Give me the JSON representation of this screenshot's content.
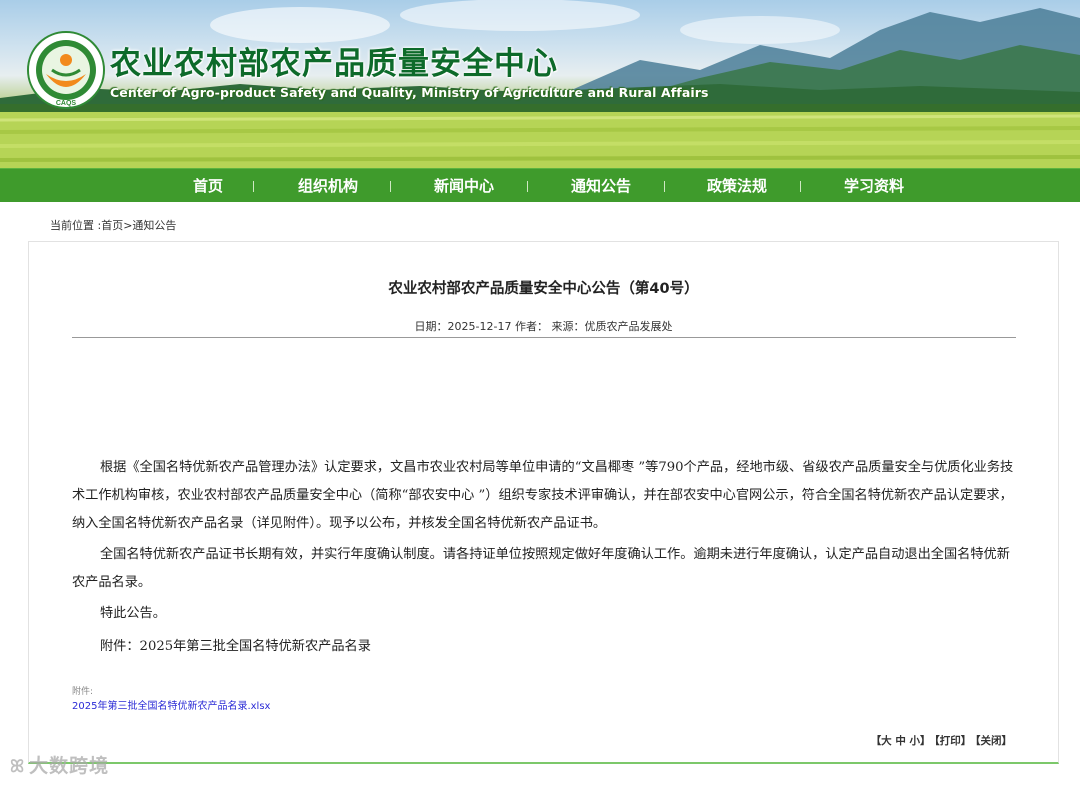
{
  "header": {
    "title": "农业农村部农产品质量安全中心",
    "subtitle": "Center of Agro-product Safety and Quality, Ministry of Agriculture and Rural Affairs",
    "logo_text": "CAQS"
  },
  "nav": {
    "items": [
      {
        "label": "首页"
      },
      {
        "label": "组织机构"
      },
      {
        "label": "新闻中心"
      },
      {
        "label": "通知公告"
      },
      {
        "label": "政策法规"
      },
      {
        "label": "学习资料"
      }
    ]
  },
  "breadcrumb": {
    "prefix": "当前位置 :",
    "home": "首页",
    "separator": ">",
    "current": "通知公告"
  },
  "article": {
    "title": "农业农村部农产品质量安全中心公告（第40号）",
    "meta": "日期：2025-12-17 作者： 来源：优质农产品发展处",
    "paragraphs": [
      "根据《全国名特优新农产品管理办法》认定要求，文昌市农业农村局等单位申请的“文昌椰枣 ”等790个产品，经地市级、省级农产品质量安全与优质化业务技术工作机构审核，农业农村部农产品质量安全中心（简称“部农安中心 ”）组织专家技术评审确认，并在部农安中心官网公示，符合全国名特优新农产品认定要求，纳入全国名特优新农产品名录（详见附件）。现予以公布，并核发全国名特优新农产品证书。",
      "全国名特优新农产品证书长期有效，并实行年度确认制度。请各持证单位按照规定做好年度确认工作。逾期未进行年度确认，认定产品自动退出全国名特优新农产品名录。",
      "特此公告。",
      "附件：2025年第三批全国名特优新农产品名录"
    ],
    "attachment_label": "附件:",
    "attachment_link": "2025年第三批全国名特优新农产品名录.xlsx"
  },
  "tools": {
    "font_size": "【大 中 小】",
    "print": "【打印】",
    "close": "【关闭】"
  },
  "watermark": {
    "text": "大数跨境"
  },
  "colors": {
    "nav_green": "#3f9b2c",
    "title_green": "#0d6a2a",
    "link_blue": "#2b2bd6",
    "logo_orange": "#f28a1c"
  }
}
